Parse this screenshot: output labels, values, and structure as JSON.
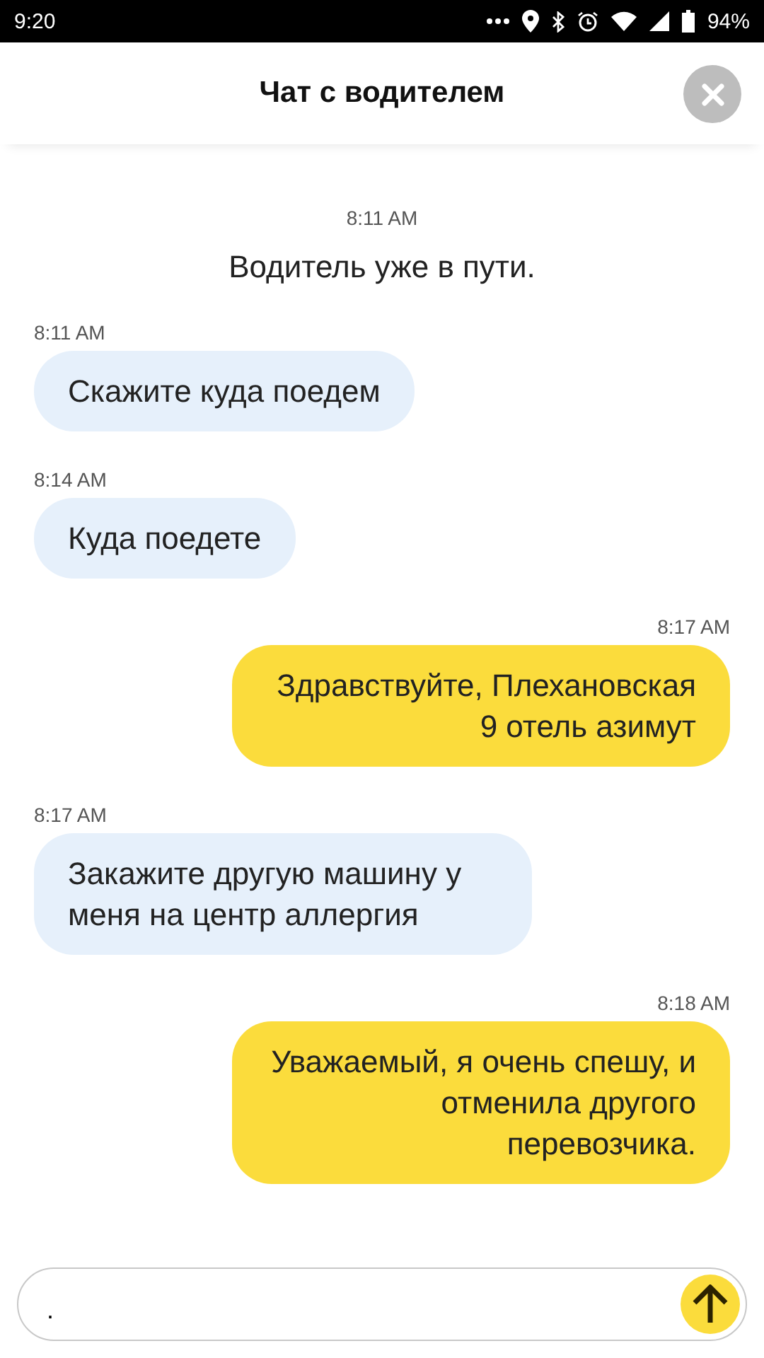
{
  "status_bar": {
    "time": "9:20",
    "battery": "94%"
  },
  "header": {
    "title": "Чат с водителем"
  },
  "messages": [
    {
      "kind": "system",
      "time": "8:11 AM",
      "text": "Водитель уже в пути."
    },
    {
      "kind": "incoming",
      "time": "8:11 AM",
      "text": "Скажите куда поедем"
    },
    {
      "kind": "incoming",
      "time": "8:14 AM",
      "text": "Куда поедете"
    },
    {
      "kind": "outgoing",
      "time": "8:17 AM",
      "text": "Здравствуйте, Плехановская 9 отель азимут"
    },
    {
      "kind": "incoming",
      "time": "8:17 AM",
      "text": "Закажите другую машину у меня на центр аллергия"
    },
    {
      "kind": "outgoing",
      "time": "8:18 AM",
      "text": "Уважаемый, я очень спешу, и отменила другого перевозчика."
    }
  ],
  "input": {
    "value": "."
  }
}
